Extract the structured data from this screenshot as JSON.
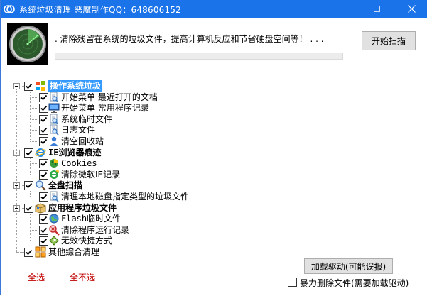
{
  "window": {
    "title": "系统垃圾清理  恶魔制作QQ：648606152",
    "accent": "#1a73e8"
  },
  "header": {
    "description": ".    清除残留在系统的垃圾文件，提高计算机反应和节省硬盘空间等！ . . .",
    "scan_button": "开始扫描",
    "progress": 0
  },
  "tree": [
    {
      "label": "操作系统垃圾",
      "icon": "windows-logo-icon",
      "bold": true,
      "selected": true,
      "checked": true,
      "children": [
        {
          "label": "开始菜单 最近打开的文档",
          "icon": "search-document-icon",
          "checked": true
        },
        {
          "label": "开始菜单 常用程序记录",
          "icon": "monitor-icon",
          "checked": true
        },
        {
          "label": "系统临时文件",
          "icon": "search-document-icon",
          "checked": true
        },
        {
          "label": "日志文件",
          "icon": "search-document-icon",
          "checked": true
        },
        {
          "label": "清空回收站",
          "icon": "user-icon",
          "checked": true
        }
      ]
    },
    {
      "label": "IE浏览器痕迹",
      "icon": "ie-icon",
      "bold": true,
      "checked": true,
      "children": [
        {
          "label": "Cookies",
          "icon": "cookie-icon",
          "checked": true
        },
        {
          "label": "清除微软IE记录",
          "icon": "ie-refresh-icon",
          "checked": true
        }
      ]
    },
    {
      "label": "全盘扫描",
      "icon": "magnifier-icon",
      "bold": true,
      "checked": true,
      "children": [
        {
          "label": "清理本地磁盘指定类型的垃圾文件",
          "icon": "search-document-icon",
          "checked": true
        }
      ]
    },
    {
      "label": "应用程序垃圾文件",
      "icon": "package-icon",
      "bold": true,
      "checked": true,
      "children": [
        {
          "label": "Flash临时文件",
          "icon": "globe-icon",
          "checked": true
        },
        {
          "label": "清除程序运行记录",
          "icon": "magnifier-red-icon",
          "checked": true
        },
        {
          "label": "无效快捷方式",
          "icon": "shortcut-icon",
          "checked": true
        }
      ]
    },
    {
      "label": "其他综合清理",
      "icon": "grid-icon",
      "bold": false,
      "checked": true,
      "children": []
    }
  ],
  "footer": {
    "select_all": "全选",
    "select_none": "全不选",
    "load_driver": "加载驱动(可能误报)",
    "force_delete_label": "暴力删除文件(需要加载驱动)",
    "force_delete_checked": false
  }
}
